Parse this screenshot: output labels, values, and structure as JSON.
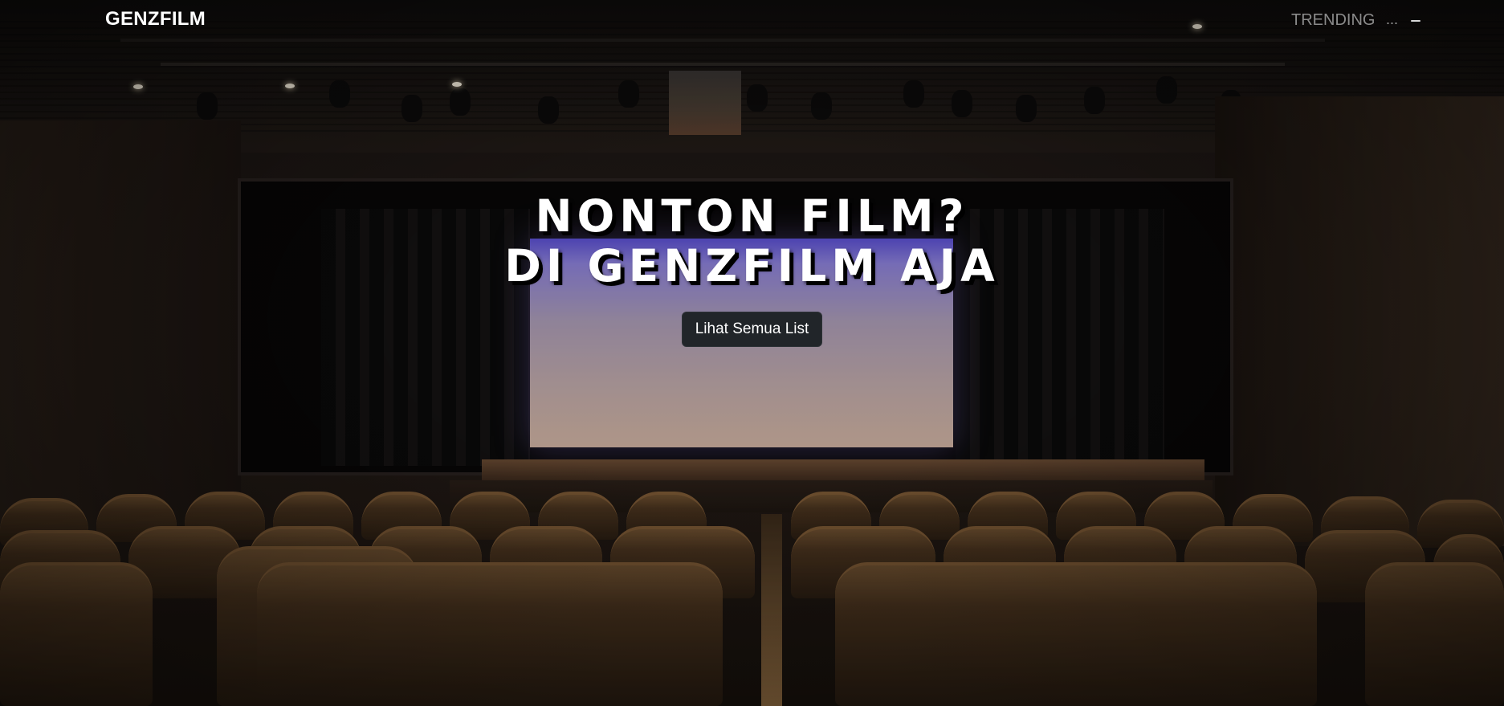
{
  "navbar": {
    "brand": "GENZFILM",
    "links": [
      {
        "label": "TRENDING"
      }
    ],
    "more_label": "..."
  },
  "hero": {
    "title_line1": "NONTON FILM?",
    "title_line2": "DI GENZFILM AJA",
    "button_label": "Lihat Semua List"
  },
  "background": {
    "image": "theater-auditorium-photo"
  },
  "colors": {
    "button_bg": "#212529",
    "title_text": "#ffffff",
    "nav_link": "#8b8b8b"
  }
}
